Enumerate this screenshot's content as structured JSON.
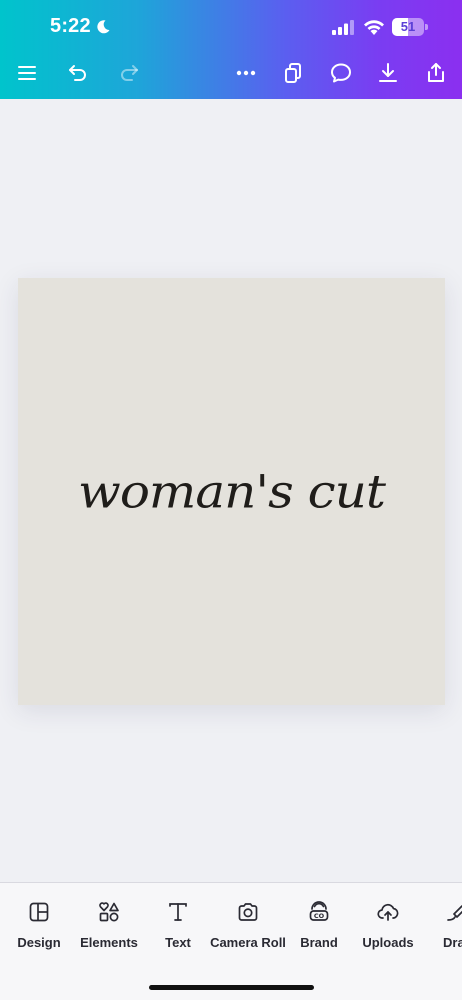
{
  "status_bar": {
    "time": "5:22",
    "battery_percent": "51",
    "battery_level": 0.51
  },
  "toolbar": {
    "icons": [
      "menu-icon",
      "undo-icon",
      "redo-icon",
      "more-icon",
      "pages-icon",
      "comment-icon",
      "download-icon",
      "share-icon"
    ]
  },
  "canvas": {
    "text": "woman's cut",
    "background_color": "#e4e2dc"
  },
  "bottom_tabs": [
    {
      "label": "Design",
      "icon": "design-icon"
    },
    {
      "label": "Elements",
      "icon": "elements-icon"
    },
    {
      "label": "Text",
      "icon": "text-icon"
    },
    {
      "label": "Camera Roll",
      "icon": "camera-icon"
    },
    {
      "label": "Brand",
      "icon": "brand-icon"
    },
    {
      "label": "Uploads",
      "icon": "uploads-icon"
    },
    {
      "label": "Dra",
      "icon": "draw-icon"
    }
  ],
  "colors": {
    "gradient_start": "#00c4cc",
    "gradient_end": "#8b2ff0"
  }
}
